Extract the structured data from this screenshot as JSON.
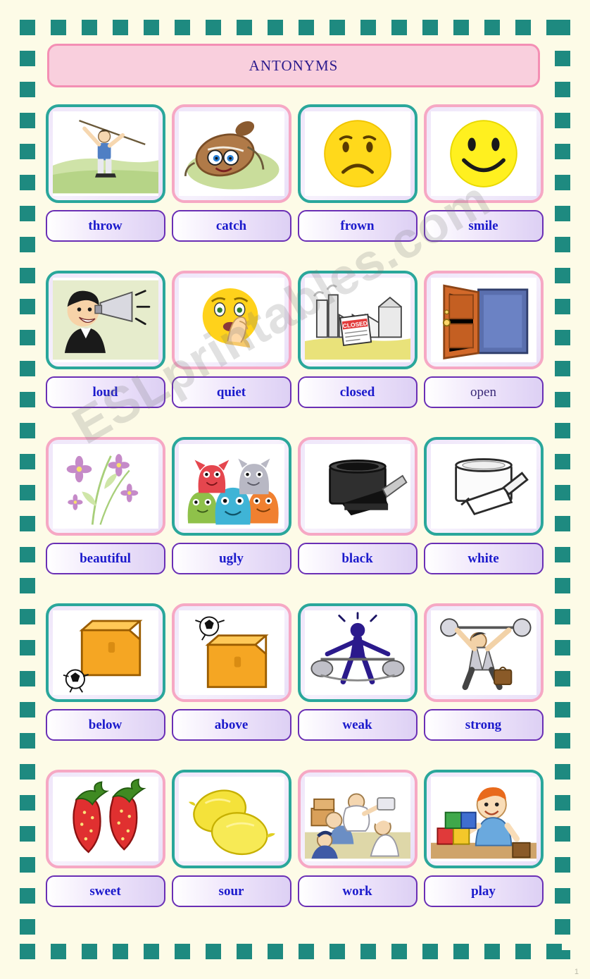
{
  "document": {
    "title": "ANTONYMS",
    "watermark": "ESLprintables.com",
    "corner_mark": "1"
  },
  "colors": {
    "border_dash": "#1e8a80",
    "title_fill": "#f9cfdd",
    "title_border": "#f48fb4",
    "title_text": "#2b1a8c",
    "card_pink": "#f6a8c4",
    "card_teal": "#2aa79b",
    "word_border": "#6a2fb5",
    "word_text": "#1b1acc",
    "page_bg": "#fdfbe7"
  },
  "rows": [
    {
      "cells": [
        {
          "label": "throw",
          "icon": "javelin-thrower-icon",
          "frame": "teal",
          "bold": true
        },
        {
          "label": "catch",
          "icon": "football-catch-icon",
          "frame": "pink",
          "bold": true
        },
        {
          "label": "frown",
          "icon": "frowning-face-icon",
          "frame": "teal",
          "bold": true
        },
        {
          "label": "smile",
          "icon": "smiling-face-icon",
          "frame": "pink",
          "bold": true
        }
      ]
    },
    {
      "cells": [
        {
          "label": "loud",
          "icon": "man-megaphone-icon",
          "frame": "teal",
          "bold": true
        },
        {
          "label": "quiet",
          "icon": "shushing-face-icon",
          "frame": "pink",
          "bold": true
        },
        {
          "label": "closed",
          "icon": "closed-factory-icon",
          "frame": "teal",
          "bold": true
        },
        {
          "label": "open",
          "icon": "open-door-icon",
          "frame": "pink",
          "bold": false
        }
      ]
    },
    {
      "cells": [
        {
          "label": "beautiful",
          "icon": "flowers-icon",
          "frame": "pink",
          "bold": true
        },
        {
          "label": "ugly",
          "icon": "ugly-monsters-icon",
          "frame": "teal",
          "bold": true
        },
        {
          "label": "black",
          "icon": "black-paint-can-icon",
          "frame": "pink",
          "bold": true
        },
        {
          "label": "white",
          "icon": "white-paint-can-icon",
          "frame": "teal",
          "bold": true
        }
      ]
    },
    {
      "cells": [
        {
          "label": "below",
          "icon": "ball-below-box-icon",
          "frame": "teal",
          "bold": true
        },
        {
          "label": "above",
          "icon": "ball-above-box-icon",
          "frame": "pink",
          "bold": true
        },
        {
          "label": "weak",
          "icon": "weak-lifter-icon",
          "frame": "teal",
          "bold": true
        },
        {
          "label": "strong",
          "icon": "strong-lifter-icon",
          "frame": "pink",
          "bold": true
        }
      ]
    },
    {
      "cells": [
        {
          "label": "sweet",
          "icon": "strawberries-icon",
          "frame": "pink",
          "bold": true
        },
        {
          "label": "sour",
          "icon": "lemons-icon",
          "frame": "teal",
          "bold": true
        },
        {
          "label": "work",
          "icon": "workers-icon",
          "frame": "pink",
          "bold": true
        },
        {
          "label": "play",
          "icon": "boy-blocks-icon",
          "frame": "teal",
          "bold": true
        }
      ]
    }
  ]
}
